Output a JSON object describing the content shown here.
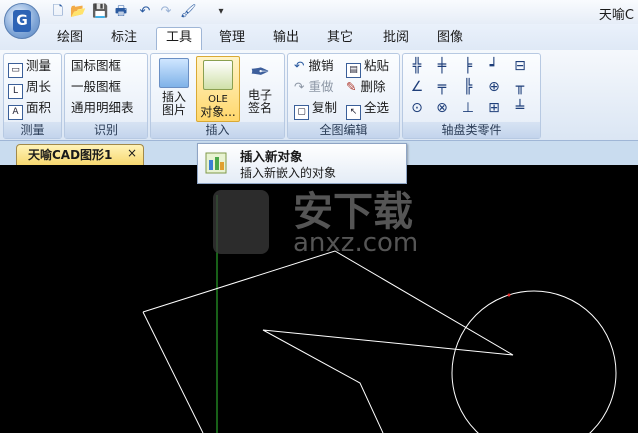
{
  "app": {
    "title": "天喻C"
  },
  "quick_access": [
    "new-icon",
    "open-icon",
    "save-icon",
    "print-preview-icon",
    "undo-icon",
    "redo-icon",
    "brush-icon",
    "dropdown-icon"
  ],
  "tabs": [
    "绘图",
    "标注",
    "工具",
    "管理",
    "输出",
    "其它",
    "批阅",
    "图像"
  ],
  "active_tab": "工具",
  "ribbon": {
    "measure": {
      "label": "测量",
      "items": [
        "测量",
        "周长",
        "面积"
      ]
    },
    "identify": {
      "label": "识别",
      "items": [
        "国标图框",
        "一般图框",
        "通用明细表"
      ]
    },
    "insert": {
      "label": "插入",
      "picture": "插入\n图片",
      "ole1": "OLE",
      "ole2": "对象...",
      "sign1": "电子",
      "sign2": "签名",
      "picture1": "插入",
      "picture2": "图片"
    },
    "edit": {
      "label": "全图编辑",
      "undo": "撤销",
      "paste": "粘贴",
      "redo": "重做",
      "delete": "删除",
      "copy": "复制",
      "select_all": "全选"
    },
    "axis": {
      "label": "轴盘类零件"
    }
  },
  "document": {
    "tab_label": "天喻CAD图形1",
    "close": "×"
  },
  "tooltip": {
    "title": "插入新对象",
    "description": "插入新嵌入的对象"
  },
  "watermark": {
    "text_cn": "安下载",
    "text_en": "anxz.com"
  }
}
